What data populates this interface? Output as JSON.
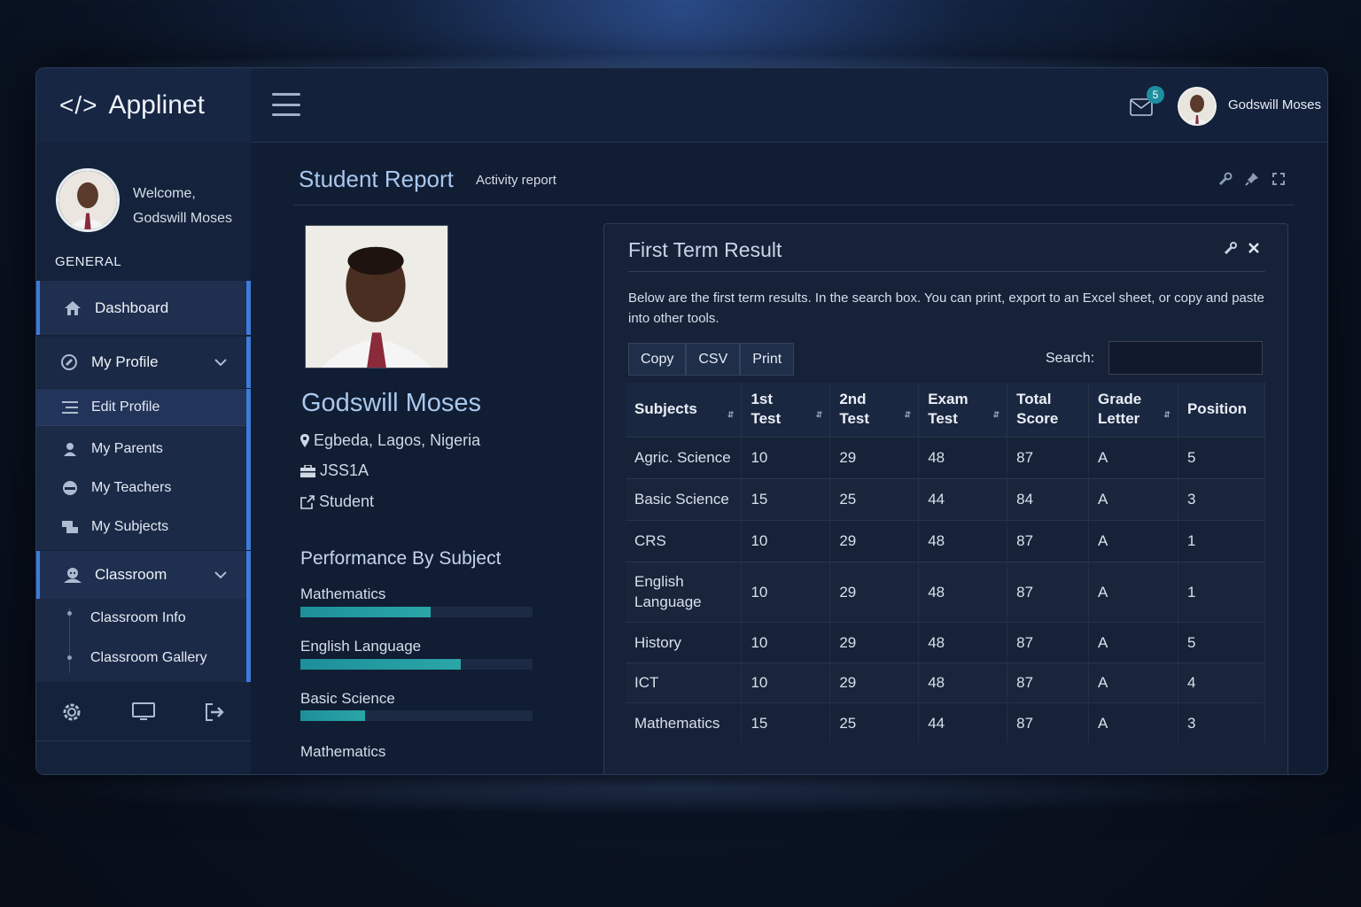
{
  "app": {
    "brand_icon": "</>",
    "brand_name": "Applinet"
  },
  "topbar": {
    "mail_count": "5",
    "user_name": "Godswill Moses"
  },
  "sidebar": {
    "welcome": "Welcome,",
    "user_name": "Godswill Moses",
    "section_label": "GENERAL",
    "dashboard": "Dashboard",
    "my_profile": "My Profile",
    "profile_items": [
      "Edit Profile",
      "My Parents",
      "My Teachers",
      "My Subjects"
    ],
    "classroom": "Classroom",
    "classroom_items": [
      "Classroom Info",
      "Classroom Gallery"
    ]
  },
  "page": {
    "title": "Student Report",
    "subtitle": "Activity report"
  },
  "student": {
    "name": "Godswill Moses",
    "location": "Egbeda, Lagos, Nigeria",
    "class": "JSS1A",
    "role": "Student"
  },
  "performance": {
    "title": "Performance By Subject",
    "items": [
      {
        "label": "Mathematics",
        "fraction": 0.56
      },
      {
        "label": "English Language",
        "fraction": 0.69
      },
      {
        "label": "Basic Science",
        "fraction": 0.28
      },
      {
        "label": "Mathematics",
        "fraction": null
      }
    ]
  },
  "results": {
    "title": "First Term Result",
    "description": "Below are the first term results. In the search box. You can print, export to an Excel sheet, or copy and paste into other tools.",
    "buttons": [
      "Copy",
      "CSV",
      "Print"
    ],
    "search_label": "Search:",
    "search_value": "",
    "headers": [
      [
        "Subjects",
        ""
      ],
      [
        "1st",
        "Test"
      ],
      [
        "2nd",
        "Test"
      ],
      [
        "Exam",
        "Test"
      ],
      [
        "Total",
        "Score"
      ],
      [
        "Grade",
        "Letter"
      ],
      [
        "Position",
        ""
      ]
    ],
    "rows": [
      [
        "Agric. Science",
        "10",
        "29",
        "48",
        "87",
        "A",
        "5"
      ],
      [
        "Basic Science",
        "15",
        "25",
        "44",
        "84",
        "A",
        "3"
      ],
      [
        "CRS",
        "10",
        "29",
        "48",
        "87",
        "A",
        "1"
      ],
      [
        "English Language",
        "10",
        "29",
        "48",
        "87",
        "A",
        "1"
      ],
      [
        "History",
        "10",
        "29",
        "48",
        "87",
        "A",
        "5"
      ],
      [
        "ICT",
        "10",
        "29",
        "48",
        "87",
        "A",
        "4"
      ],
      [
        "Mathematics",
        "15",
        "25",
        "44",
        "87",
        "A",
        "3"
      ]
    ]
  },
  "colors": {
    "accent": "#3d7bd8",
    "progress": "#2aa6a8",
    "title": "#a9c8ee"
  }
}
